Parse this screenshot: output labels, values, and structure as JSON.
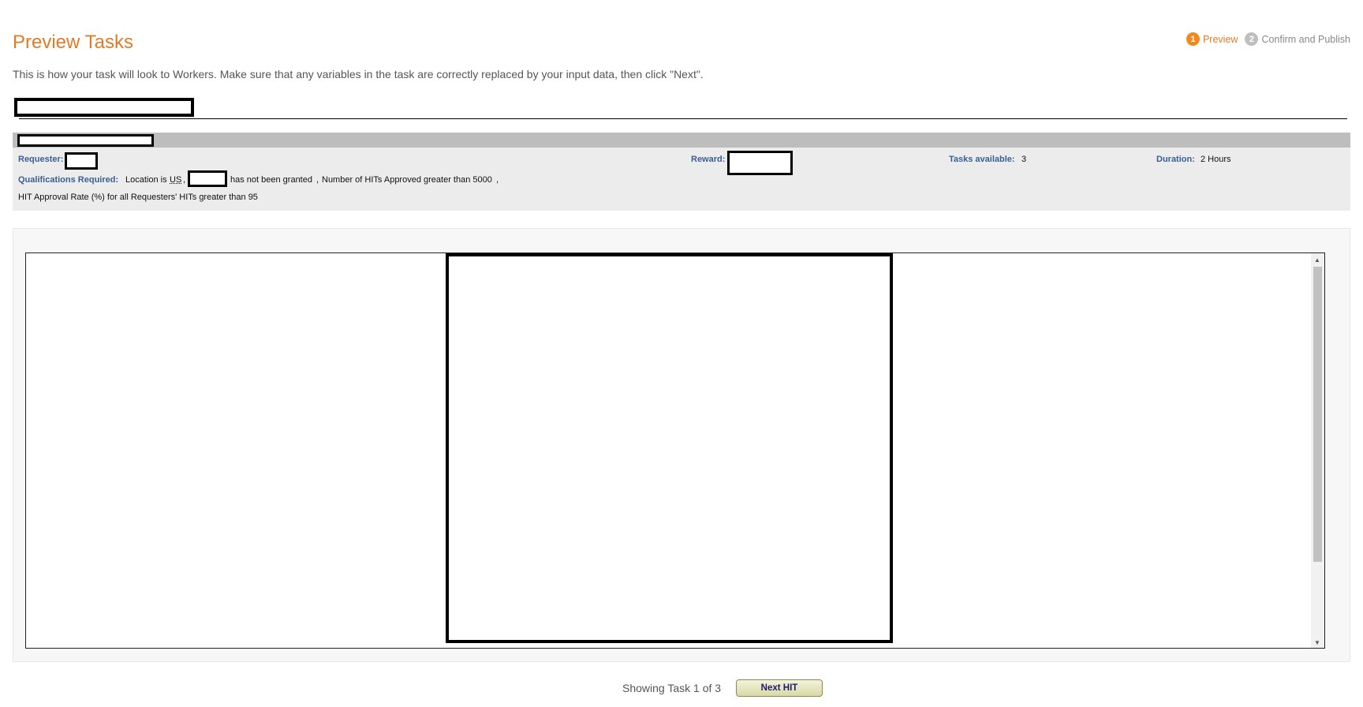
{
  "header": {
    "title": "Preview Tasks",
    "steps": [
      {
        "number": "1",
        "label": "Preview"
      },
      {
        "number": "2",
        "label": "Confirm and Publish"
      }
    ]
  },
  "intro_text": "This is how your task will look to Workers. Make sure that any variables in the task are correctly replaced by your input data, then click \"Next\".",
  "hit_info": {
    "requester_label": "Requester:",
    "reward_label": "Reward:",
    "tasks_available_label": "Tasks available:",
    "tasks_available_value": "3",
    "duration_label": "Duration:",
    "duration_value": "2 Hours",
    "qualifications_label": "Qualifications Required:",
    "qual_location_prefix": "Location is",
    "qual_location_value": "US",
    "qual_sep": ",",
    "qual_not_granted": "has not been granted",
    "qual_hits_approved": "Number of HITs Approved greater than 5000",
    "qual_approval_rate": "HIT Approval Rate (%) for all Requesters' HITs greater than 95"
  },
  "footer": {
    "showing_text": "Showing Task 1 of 3",
    "next_button_label": "Next HIT"
  },
  "scrollbar": {
    "up_arrow": "▲",
    "down_arrow": "▼"
  }
}
